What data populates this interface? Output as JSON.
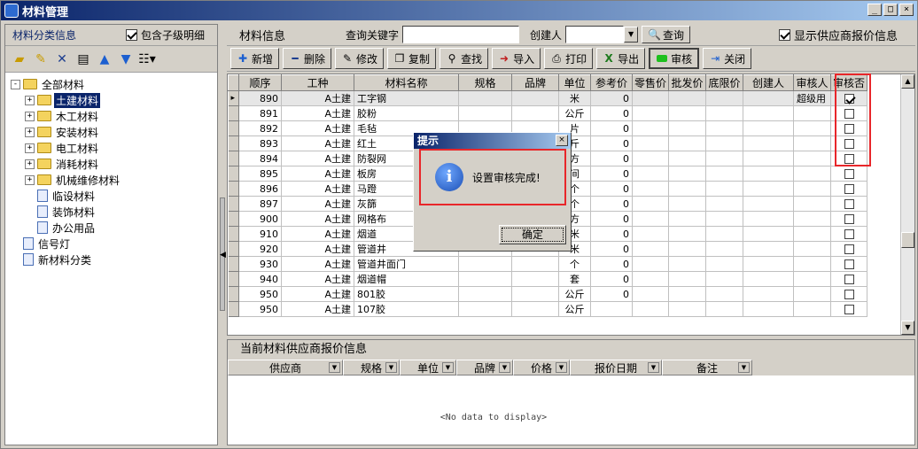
{
  "window": {
    "title": "材料管理"
  },
  "left_panel": {
    "title": "材料分类信息",
    "include_sub_label": "包含子级明细",
    "include_sub_checked": true,
    "tree": [
      {
        "label": "全部材料",
        "level": 0,
        "type": "folder",
        "expander": "-"
      },
      {
        "label": "土建材料",
        "level": 1,
        "type": "folder",
        "expander": "+",
        "selected": true
      },
      {
        "label": "木工材料",
        "level": 1,
        "type": "folder",
        "expander": "+"
      },
      {
        "label": "安装材料",
        "level": 1,
        "type": "folder",
        "expander": "+"
      },
      {
        "label": "电工材料",
        "level": 1,
        "type": "folder",
        "expander": "+"
      },
      {
        "label": "消耗材料",
        "level": 1,
        "type": "folder",
        "expander": "+"
      },
      {
        "label": "机械维修材料",
        "level": 1,
        "type": "folder",
        "expander": "+"
      },
      {
        "label": "临设材料",
        "level": 1,
        "type": "doc"
      },
      {
        "label": "装饰材料",
        "level": 1,
        "type": "doc"
      },
      {
        "label": "办公用品",
        "level": 1,
        "type": "doc"
      },
      {
        "label": "信号灯",
        "level": 0,
        "type": "doc"
      },
      {
        "label": "新材料分类",
        "level": 0,
        "type": "doc"
      }
    ]
  },
  "right_panel": {
    "title": "材料信息",
    "keyword_label": "查询关键字",
    "keyword_value": "",
    "creator_label": "创建人",
    "creator_value": "",
    "query_button": "查询",
    "show_supplier_label": "显示供应商报价信息",
    "show_supplier_checked": true
  },
  "toolbar": {
    "add": "新增",
    "delete": "删除",
    "edit": "修改",
    "copy": "复制",
    "find": "查找",
    "import": "导入",
    "print": "打印",
    "export": "导出",
    "audit": "审核",
    "close": "关闭"
  },
  "grid": {
    "columns": [
      "顺序",
      "工种",
      "材料名称",
      "规格",
      "品牌",
      "单位",
      "参考价",
      "零售价",
      "批发价",
      "底限价",
      "创建人",
      "审核人",
      "审核否"
    ],
    "rows": [
      {
        "seq": "890",
        "type": "A土建",
        "name": "工字钢",
        "spec": "",
        "brand": "",
        "unit": "米",
        "ref": "0",
        "auditor": "超级用",
        "audited": true
      },
      {
        "seq": "891",
        "type": "A土建",
        "name": "胶粉",
        "spec": "",
        "brand": "",
        "unit": "公斤",
        "ref": "0",
        "auditor": "",
        "audited": false
      },
      {
        "seq": "892",
        "type": "A土建",
        "name": "毛毡",
        "spec": "",
        "brand": "",
        "unit": "片",
        "ref": "0",
        "auditor": "",
        "audited": false
      },
      {
        "seq": "893",
        "type": "A土建",
        "name": "红土",
        "spec": "",
        "brand": "",
        "unit": "斤",
        "ref": "0",
        "auditor": "",
        "audited": false
      },
      {
        "seq": "894",
        "type": "A土建",
        "name": "防裂网",
        "spec": "",
        "brand": "",
        "unit": "方",
        "ref": "0",
        "auditor": "",
        "audited": false
      },
      {
        "seq": "895",
        "type": "A土建",
        "name": "板房",
        "spec": "",
        "brand": "",
        "unit": "间",
        "ref": "0",
        "auditor": "",
        "audited": false
      },
      {
        "seq": "896",
        "type": "A土建",
        "name": "马蹬",
        "spec": "",
        "brand": "",
        "unit": "个",
        "ref": "0",
        "auditor": "",
        "audited": false
      },
      {
        "seq": "897",
        "type": "A土建",
        "name": "灰篩",
        "spec": "",
        "brand": "",
        "unit": "个",
        "ref": "0",
        "auditor": "",
        "audited": false
      },
      {
        "seq": "900",
        "type": "A土建",
        "name": "网格布",
        "spec": "",
        "brand": "",
        "unit": "方",
        "ref": "0",
        "auditor": "",
        "audited": false
      },
      {
        "seq": "910",
        "type": "A土建",
        "name": "烟道",
        "spec": "",
        "brand": "",
        "unit": "米",
        "ref": "0",
        "auditor": "",
        "audited": false
      },
      {
        "seq": "920",
        "type": "A土建",
        "name": "管道井",
        "spec": "",
        "brand": "",
        "unit": "米",
        "ref": "0",
        "auditor": "",
        "audited": false
      },
      {
        "seq": "930",
        "type": "A土建",
        "name": "管道井面门",
        "spec": "",
        "brand": "",
        "unit": "个",
        "ref": "0",
        "auditor": "",
        "audited": false
      },
      {
        "seq": "940",
        "type": "A土建",
        "name": "烟道帽",
        "spec": "",
        "brand": "",
        "unit": "套",
        "ref": "0",
        "auditor": "",
        "audited": false
      },
      {
        "seq": "950",
        "type": "A土建",
        "name": "801胶",
        "spec": "",
        "brand": "",
        "unit": "公斤",
        "ref": "0",
        "auditor": "",
        "audited": false
      },
      {
        "seq": "950",
        "type": "A土建",
        "name": "107胶",
        "spec": "",
        "brand": "",
        "unit": "公斤",
        "ref": "",
        "auditor": "",
        "audited": false
      }
    ]
  },
  "supplier": {
    "title": "当前材料供应商报价信息",
    "columns": [
      "供应商",
      "规格",
      "单位",
      "品牌",
      "价格",
      "报价日期",
      "备注"
    ],
    "empty_text": "<No data to display>"
  },
  "dialog": {
    "title": "提示",
    "message": "设置审核完成!",
    "ok_button": "确定"
  }
}
